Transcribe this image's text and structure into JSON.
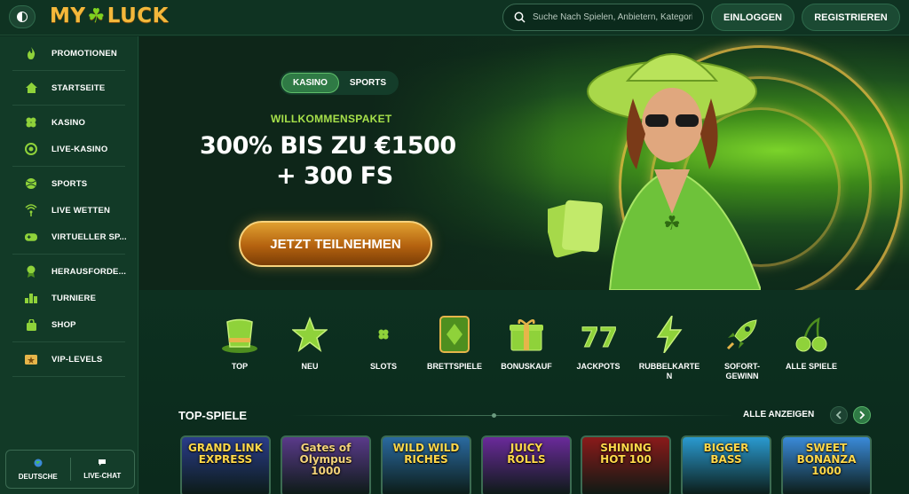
{
  "header": {
    "logo_left": "MY",
    "logo_right": "LUCK",
    "search_placeholder": "Suche Nach Spielen, Anbietern, Kategorien",
    "login_label": "EINLOGGEN",
    "register_label": "REGISTRIEREN"
  },
  "sidebar": {
    "groups": [
      [
        {
          "label": "PROMOTIONEN",
          "icon": "flame-icon"
        }
      ],
      [
        {
          "label": "STARTSEITE",
          "icon": "home-icon"
        }
      ],
      [
        {
          "label": "KASINO",
          "icon": "clover-icon"
        },
        {
          "label": "LIVE-KASINO",
          "icon": "chip-icon"
        }
      ],
      [
        {
          "label": "SPORTS",
          "icon": "ball-icon"
        },
        {
          "label": "LIVE WETTEN",
          "icon": "broadcast-icon"
        },
        {
          "label": "VIRTUELLER SP...",
          "icon": "gamepad-icon"
        }
      ],
      [
        {
          "label": "HERAUSFORDE...",
          "icon": "medal-icon"
        },
        {
          "label": "TURNIERE",
          "icon": "podium-icon"
        },
        {
          "label": "SHOP",
          "icon": "bag-icon"
        }
      ],
      [
        {
          "label": "VIP-LEVELS",
          "icon": "ticket-icon"
        }
      ]
    ],
    "language_label": "DEUTSCHE",
    "chat_label": "LIVE-CHAT"
  },
  "hero": {
    "tab_casino": "KASINO",
    "tab_sports": "SPORTS",
    "subtitle": "WILLKOMMENSPAKET",
    "line1": "300% BIS ZU €1500",
    "line2": "+ 300 FS",
    "cta_label": "JETZT TEILNEHMEN"
  },
  "categories": [
    {
      "label": "TOP",
      "icon": "top-hat-icon"
    },
    {
      "label": "NEU",
      "icon": "star-icon"
    },
    {
      "label": "SLOTS",
      "icon": "clover-icon"
    },
    {
      "label": "BRETTSPIELE",
      "icon": "card-icon"
    },
    {
      "label": "BONUSKAUF",
      "icon": "gift-icon"
    },
    {
      "label": "JACKPOTS",
      "icon": "sevens-icon"
    },
    {
      "label": "RUBBELKARTE\nN",
      "icon": "lightning-icon"
    },
    {
      "label": "SOFORT-\nGEWINN",
      "icon": "rocket-icon"
    },
    {
      "label": "ALLE SPIELE",
      "icon": "cherries-icon"
    }
  ],
  "top_games": {
    "title": "TOP-SPIELE",
    "all_label": "ALLE ANZEIGEN",
    "games": [
      {
        "name": "GRAND LINK\nEXPRESS",
        "color": "#2a3c8a"
      },
      {
        "name": "Gates of Olympus\n1000",
        "color": "#5a3a8a"
      },
      {
        "name": "WILD WILD\nRICHES",
        "color": "#2a6aa0"
      },
      {
        "name": "JUICY\nROLLS",
        "color": "#6a2a9a"
      },
      {
        "name": "SHINING\nHOT 100",
        "color": "#8a1a1a"
      },
      {
        "name": "BIGGER\nBASS",
        "color": "#2a9ad0"
      },
      {
        "name": "SWEET\nBONANZA 1000",
        "color": "#3a8ad8"
      }
    ]
  },
  "colors": {
    "accent_green": "#2f7a45",
    "brand_gold": "#f3b83b",
    "promo_green": "#a6e04a"
  }
}
